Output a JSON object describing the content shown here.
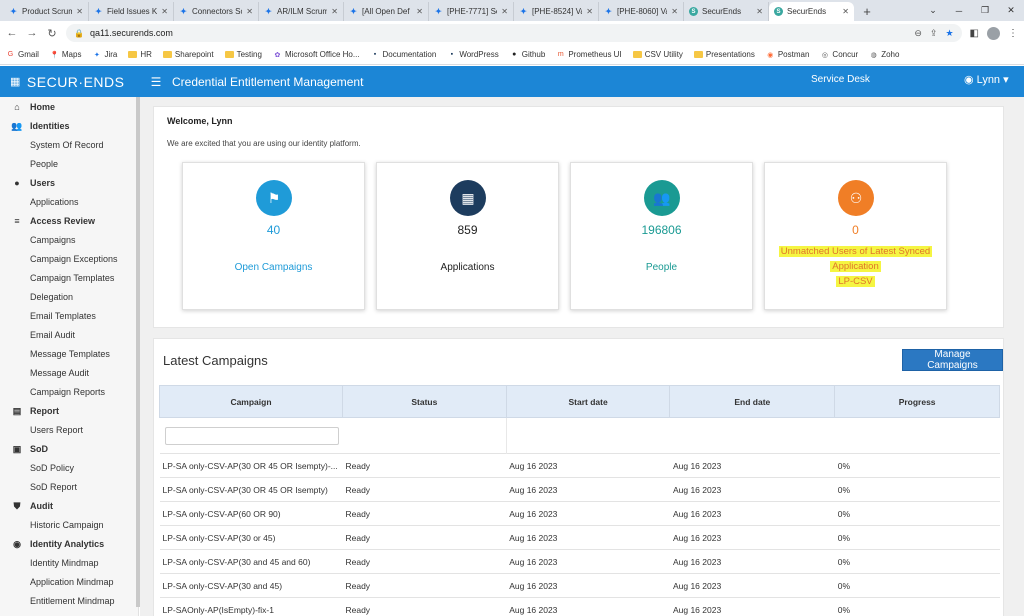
{
  "browser": {
    "tabs": [
      {
        "title": "Product Scrum",
        "icon": "jira-icon"
      },
      {
        "title": "Field Issues Ka",
        "icon": "jira-icon"
      },
      {
        "title": "Connectors Sc",
        "icon": "jira-icon"
      },
      {
        "title": "AR/ILM Scrum",
        "icon": "jira-icon"
      },
      {
        "title": "[All Open Def",
        "icon": "jira-icon"
      },
      {
        "title": "[PHE-7771] Se",
        "icon": "jira-icon"
      },
      {
        "title": "[PHE-8524] Va",
        "icon": "jira-icon"
      },
      {
        "title": "[PHE-8060] Va",
        "icon": "jira-icon"
      },
      {
        "title": "SecurEnds",
        "icon": "securends-icon"
      },
      {
        "title": "SecurEnds",
        "icon": "securends-icon",
        "active": true
      }
    ],
    "url": "qa11.securends.com",
    "bookmarks": [
      "Gmail",
      "Maps",
      "Jira",
      "HR",
      "Sharepoint",
      "Testing",
      "Microsoft Office Ho...",
      "Documentation",
      "WordPress",
      "Github",
      "Prometheus UI",
      "CSV Utility",
      "Presentations",
      "Postman",
      "Concur",
      "Zoho"
    ]
  },
  "header": {
    "logo": "SECUR·ENDS",
    "title": "Credential Entitlement Management",
    "service_desk": "Service Desk",
    "user": "Lynn"
  },
  "sidebar": {
    "items": [
      {
        "label": "Home",
        "type": "section",
        "icon": "home-icon"
      },
      {
        "label": "Identities",
        "type": "section",
        "icon": "users-icon"
      },
      {
        "label": "System Of Record",
        "type": "child"
      },
      {
        "label": "People",
        "type": "child"
      },
      {
        "label": "Users",
        "type": "section",
        "icon": "user-icon"
      },
      {
        "label": "Applications",
        "type": "child"
      },
      {
        "label": "Access Review",
        "type": "section",
        "icon": "list-icon"
      },
      {
        "label": "Campaigns",
        "type": "child"
      },
      {
        "label": "Campaign Exceptions",
        "type": "child"
      },
      {
        "label": "Campaign Templates",
        "type": "child"
      },
      {
        "label": "Delegation",
        "type": "child"
      },
      {
        "label": "Email Templates",
        "type": "child"
      },
      {
        "label": "Email Audit",
        "type": "child"
      },
      {
        "label": "Message Templates",
        "type": "child"
      },
      {
        "label": "Message Audit",
        "type": "child"
      },
      {
        "label": "Campaign Reports",
        "type": "child"
      },
      {
        "label": "Report",
        "type": "section",
        "icon": "file-icon"
      },
      {
        "label": "Users Report",
        "type": "child"
      },
      {
        "label": "SoD",
        "type": "section",
        "icon": "sod-icon"
      },
      {
        "label": "SoD Policy",
        "type": "child"
      },
      {
        "label": "SoD Report",
        "type": "child"
      },
      {
        "label": "Audit",
        "type": "section",
        "icon": "shield-icon"
      },
      {
        "label": "Historic Campaign",
        "type": "child"
      },
      {
        "label": "Identity Analytics",
        "type": "section",
        "icon": "analytics-icon"
      },
      {
        "label": "Identity Mindmap",
        "type": "child"
      },
      {
        "label": "Application Mindmap",
        "type": "child"
      },
      {
        "label": "Entitlement Mindmap",
        "type": "child"
      }
    ]
  },
  "welcome": {
    "title": "Welcome, Lynn",
    "subtitle": "We are excited that you are using our identity platform."
  },
  "tiles": [
    {
      "value": "40",
      "label": "Open Campaigns",
      "color": "#1f9bd8",
      "icon": "flag-icon",
      "value_color": "#1f9bd8",
      "label_color": "#1f9bd8"
    },
    {
      "value": "859",
      "label": "Applications",
      "color": "#1d3c5e",
      "icon": "grid-icon",
      "value_color": "#222222",
      "label_color": "#222222"
    },
    {
      "value": "196806",
      "label": "People",
      "color": "#1a9a93",
      "icon": "people-icon",
      "value_color": "#1a9a93",
      "label_color": "#1a9a93"
    },
    {
      "value": "0",
      "label_lines": [
        "Unmatched Users of Latest Synced",
        "Application",
        "LP-CSV"
      ],
      "color": "#f07e26",
      "icon": "user-group-icon",
      "value_color": "#f07e26",
      "label_color": "#e0762a",
      "highlight": "#f5f542"
    }
  ],
  "campaigns": {
    "title": "Latest Campaigns",
    "manage_button": "Manage Campaigns",
    "columns": [
      "Campaign",
      "Status",
      "Start date",
      "End date",
      "Progress"
    ],
    "rows": [
      [
        "LP-SA only-CSV-AP(30 OR 45 OR Isempty)-...",
        "Ready",
        "Aug 16 2023",
        "Aug 16 2023",
        "0%"
      ],
      [
        "LP-SA only-CSV-AP(30 OR 45 OR Isempty)",
        "Ready",
        "Aug 16 2023",
        "Aug 16 2023",
        "0%"
      ],
      [
        "LP-SA only-CSV-AP(60 OR 90)",
        "Ready",
        "Aug 16 2023",
        "Aug 16 2023",
        "0%"
      ],
      [
        "LP-SA only-CSV-AP(30 or 45)",
        "Ready",
        "Aug 16 2023",
        "Aug 16 2023",
        "0%"
      ],
      [
        "LP-SA only-CSV-AP(30 and 45 and 60)",
        "Ready",
        "Aug 16 2023",
        "Aug 16 2023",
        "0%"
      ],
      [
        "LP-SA only-CSV-AP(30 and 45)",
        "Ready",
        "Aug 16 2023",
        "Aug 16 2023",
        "0%"
      ],
      [
        "LP-SAOnly-AP(IsEmpty)-fix-1",
        "Ready",
        "Aug 16 2023",
        "Aug 16 2023",
        "0%"
      ]
    ]
  }
}
